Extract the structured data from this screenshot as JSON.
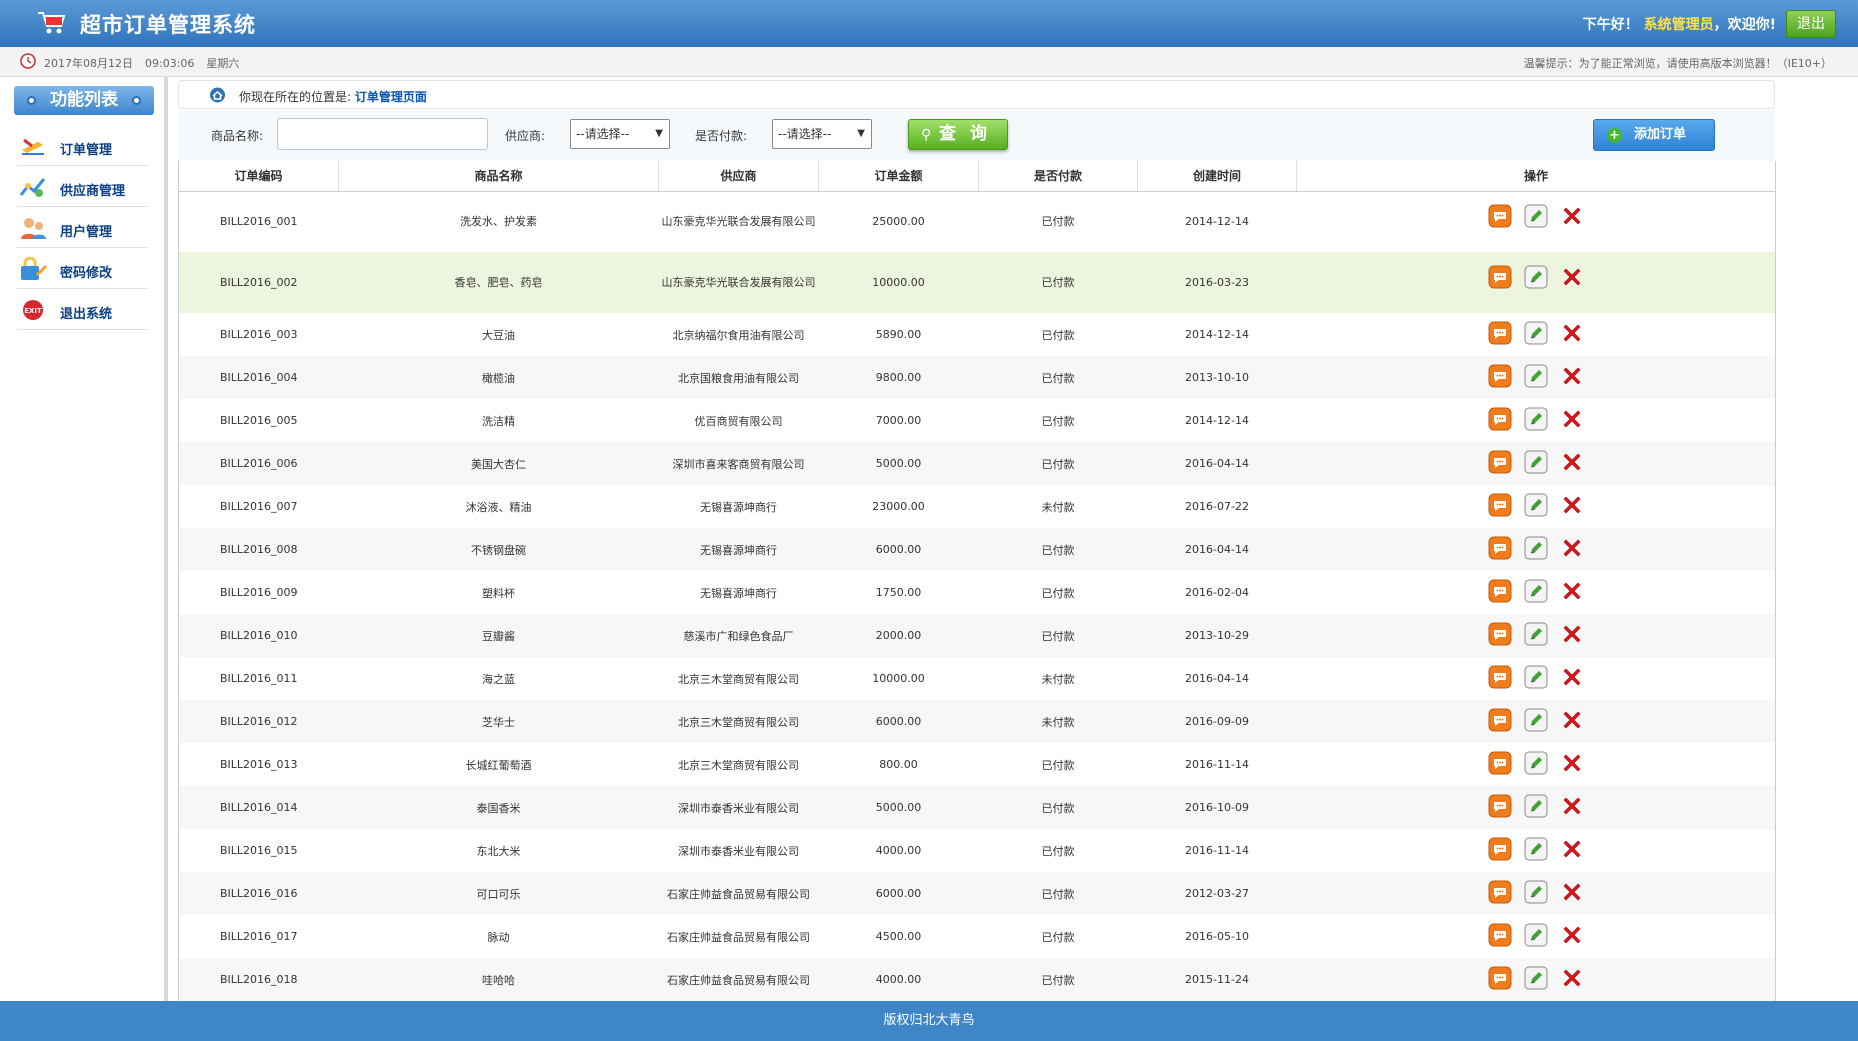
{
  "header": {
    "title": "超市订单管理系统",
    "greeting_prefix": "下午好！",
    "username": "系统管理员",
    "greeting_suffix": "，欢迎你!",
    "logout": "退出"
  },
  "subbar": {
    "date": "2017年08月12日",
    "time": "09:03:06",
    "weekday": "星期六",
    "tip": "温馨提示：为了能正常浏览，请使用高版本浏览器！（IE10+）"
  },
  "sidebar": {
    "title": "功能列表",
    "items": [
      {
        "label": "订单管理",
        "icon": "order-icon"
      },
      {
        "label": "供应商管理",
        "icon": "supplier-icon"
      },
      {
        "label": "用户管理",
        "icon": "users-icon"
      },
      {
        "label": "密码修改",
        "icon": "password-icon"
      },
      {
        "label": "退出系统",
        "icon": "exit-icon"
      }
    ]
  },
  "breadcrumb": {
    "prefix": "你现在所在的位置是:",
    "current": "订单管理页面"
  },
  "search": {
    "name_label": "商品名称:",
    "name_value": "",
    "provider_label": "供应商:",
    "provider_value": "--请选择--",
    "paid_label": "是否付款:",
    "paid_value": "--请选择--",
    "query": "查 询",
    "add": "添加订单"
  },
  "table": {
    "headers": [
      "订单编码",
      "商品名称",
      "供应商",
      "订单金额",
      "是否付款",
      "创建时间",
      "操作"
    ],
    "rows": [
      [
        "BILL2016_001",
        "洗发水、护发素",
        "山东豪克华光联合发展有限公司",
        "25000.00",
        "已付款",
        "2014-12-14"
      ],
      [
        "BILL2016_002",
        "香皂、肥皂、药皂",
        "山东豪克华光联合发展有限公司",
        "10000.00",
        "已付款",
        "2016-03-23"
      ],
      [
        "BILL2016_003",
        "大豆油",
        "北京纳福尔食用油有限公司",
        "5890.00",
        "已付款",
        "2014-12-14"
      ],
      [
        "BILL2016_004",
        "橄榄油",
        "北京国粮食用油有限公司",
        "9800.00",
        "已付款",
        "2013-10-10"
      ],
      [
        "BILL2016_005",
        "洗洁精",
        "优百商贸有限公司",
        "7000.00",
        "已付款",
        "2014-12-14"
      ],
      [
        "BILL2016_006",
        "美国大杏仁",
        "深圳市喜来客商贸有限公司",
        "5000.00",
        "已付款",
        "2016-04-14"
      ],
      [
        "BILL2016_007",
        "沐浴液、精油",
        "无锡喜源坤商行",
        "23000.00",
        "未付款",
        "2016-07-22"
      ],
      [
        "BILL2016_008",
        "不锈钢盘碗",
        "无锡喜源坤商行",
        "6000.00",
        "已付款",
        "2016-04-14"
      ],
      [
        "BILL2016_009",
        "塑料杯",
        "无锡喜源坤商行",
        "1750.00",
        "已付款",
        "2016-02-04"
      ],
      [
        "BILL2016_010",
        "豆瓣酱",
        "慈溪市广和绿色食品厂",
        "2000.00",
        "已付款",
        "2013-10-29"
      ],
      [
        "BILL2016_011",
        "海之蓝",
        "北京三木堂商贸有限公司",
        "10000.00",
        "未付款",
        "2016-04-14"
      ],
      [
        "BILL2016_012",
        "芝华士",
        "北京三木堂商贸有限公司",
        "6000.00",
        "未付款",
        "2016-09-09"
      ],
      [
        "BILL2016_013",
        "长城红葡萄酒",
        "北京三木堂商贸有限公司",
        "800.00",
        "已付款",
        "2016-11-14"
      ],
      [
        "BILL2016_014",
        "泰国香米",
        "深圳市泰香米业有限公司",
        "5000.00",
        "已付款",
        "2016-10-09"
      ],
      [
        "BILL2016_015",
        "东北大米",
        "深圳市泰香米业有限公司",
        "4000.00",
        "已付款",
        "2016-11-14"
      ],
      [
        "BILL2016_016",
        "可口可乐",
        "石家庄帅益食品贸易有限公司",
        "6000.00",
        "已付款",
        "2012-03-27"
      ],
      [
        "BILL2016_017",
        "脉动",
        "石家庄帅益食品贸易有限公司",
        "4500.00",
        "已付款",
        "2016-05-10"
      ],
      [
        "BILL2016_018",
        "哇哈哈",
        "石家庄帅益食品贸易有限公司",
        "4000.00",
        "已付款",
        "2015-11-24"
      ]
    ]
  },
  "footer": "版权归北大青鸟"
}
